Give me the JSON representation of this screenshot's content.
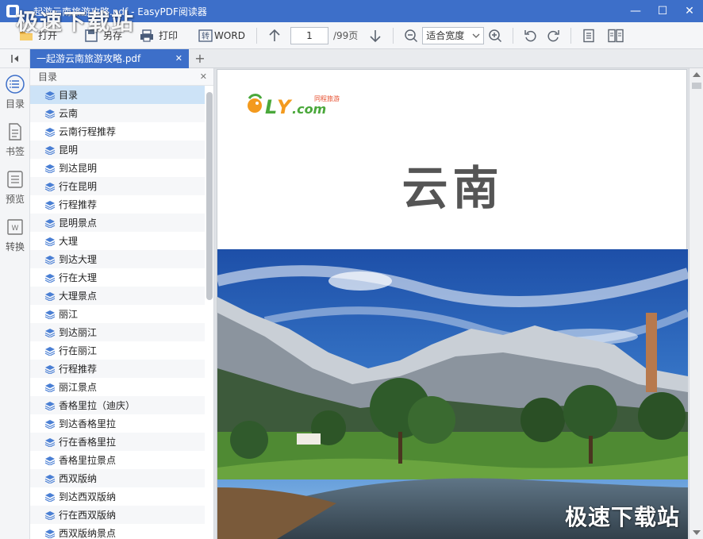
{
  "window": {
    "title": "一起游云南旅游攻略.pdf - EasyPDF阅读器",
    "controls": {
      "minimize": "—",
      "maximize": "☐",
      "close": "✕"
    }
  },
  "toolbar": {
    "open_label": "打开",
    "saveas_label": "另存",
    "print_label": "打印",
    "word_label": "WORD",
    "current_page": "1",
    "total_pages": "/99页",
    "zoom_value": "适合宽度"
  },
  "rail": {
    "items": [
      {
        "label": "目录",
        "icon": "toc-icon"
      },
      {
        "label": "书签",
        "icon": "bookmark-icon"
      },
      {
        "label": "预览",
        "icon": "preview-icon"
      },
      {
        "label": "转换",
        "icon": "convert-icon"
      }
    ]
  },
  "tab": {
    "label": "一起游云南旅游攻略.pdf",
    "close": "✕",
    "add": "+"
  },
  "panel": {
    "title": "目录",
    "close": "✕",
    "items": [
      "目录",
      "云南",
      "云南行程推荐",
      "昆明",
      "到达昆明",
      "行在昆明",
      "行程推荐",
      "昆明景点",
      "大理",
      "到达大理",
      "行在大理",
      "大理景点",
      "丽江",
      "到达丽江",
      "行在丽江",
      "行程推荐",
      "丽江景点",
      "香格里拉（迪庆）",
      "到达香格里拉",
      "行在香格里拉",
      "香格里拉景点",
      "西双版纳",
      "到达西双版纳",
      "行在西双版纳",
      "西双版纳景点"
    ],
    "selected_index": 0
  },
  "document": {
    "logo_text": "LY.com",
    "logo_sub": "同程旅游",
    "heading": "云南"
  },
  "watermark": {
    "top": "极速下载站",
    "bottom": "极速下载站"
  },
  "colors": {
    "titlebar": "#3d6fc9",
    "tab_active": "#3d6fc9",
    "selected_row": "#cde3f7"
  }
}
